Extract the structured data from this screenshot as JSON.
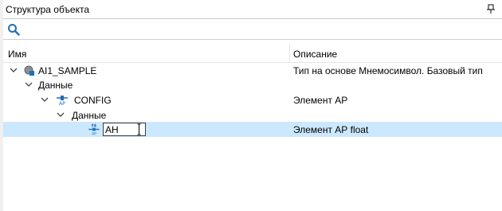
{
  "panel": {
    "title": "Структура объекта"
  },
  "search": {
    "value": "",
    "placeholder": ""
  },
  "columns": {
    "name": "Имя",
    "description": "Описание"
  },
  "tree": [
    {
      "name": "AI1_SAMPLE",
      "description": "Тип на основе Мнемосимвол. Базовый тип",
      "icon": "object-type-icon"
    },
    {
      "name": "Данные",
      "description": ""
    },
    {
      "name": "CONFIG",
      "description": "Элемент АР",
      "icon": "ap-element-icon",
      "icon_text": "AP"
    },
    {
      "name": "Данные",
      "description": ""
    },
    {
      "name": "AH",
      "description": "Элемент АР float",
      "icon": "ap-float-icon",
      "icon_text_top": "f4",
      "icon_text_bottom": "AP",
      "editing": true
    }
  ],
  "colors": {
    "selected_row": "#cce8ff",
    "accent": "#1f6fb5"
  }
}
